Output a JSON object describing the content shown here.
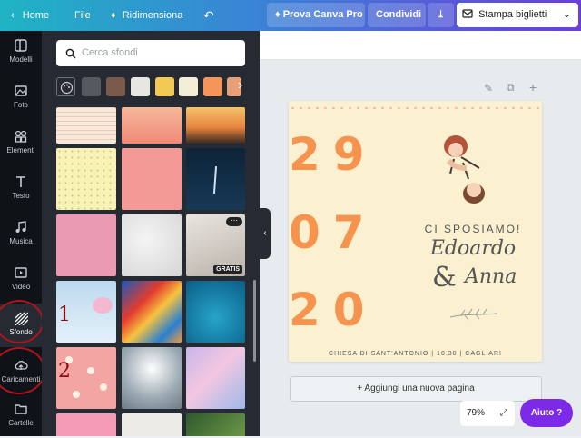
{
  "topbar": {
    "home": "Home",
    "file": "File",
    "resize": "Ridimensiona",
    "try_pro": "Prova Canva Pro",
    "share": "Condividi",
    "print": "Stampa biglietti"
  },
  "rail": {
    "items": [
      {
        "label": "Modelli"
      },
      {
        "label": "Foto"
      },
      {
        "label": "Elementi"
      },
      {
        "label": "Testo"
      },
      {
        "label": "Musica"
      },
      {
        "label": "Video"
      },
      {
        "label": "Sfondo"
      },
      {
        "label": "Caricamenti"
      },
      {
        "label": "Cartelle"
      }
    ]
  },
  "panel": {
    "search_placeholder": "Cerca sfondi",
    "free_badge": "GRATIS",
    "swatches": [
      "#555a60",
      "#7a5a4a",
      "#e8e6e1",
      "#f3c956",
      "#f4edd8",
      "#f4955a",
      "#e8a07a"
    ]
  },
  "annotations": {
    "one": "1",
    "two": "2"
  },
  "card": {
    "day": "29",
    "month": "07",
    "year": "20",
    "headline": "CI SPOSIAMO!",
    "name1": "Edoardo",
    "amp": "&",
    "name2": "Anna",
    "footer": "CHIESA DI SANT'ANTONIO | 10.30 | CAGLIARI"
  },
  "canvas": {
    "add_page": "+ Aggiungi una nuova pagina",
    "zoom": "79%",
    "help": "Aiuto ?"
  }
}
